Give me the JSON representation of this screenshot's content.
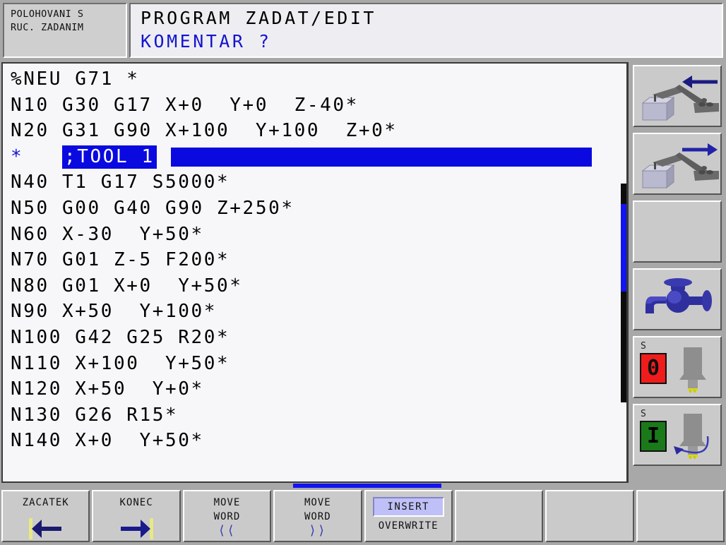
{
  "header": {
    "mode_lines": [
      "POLOHOVANI S",
      "RUC. ZADANIM"
    ],
    "title_main": "PROGRAM ZADAT/EDIT",
    "title_sub": "KOMENTAR ?"
  },
  "program": {
    "lines": [
      {
        "text": "%NEU G71 *",
        "cursor": false
      },
      {
        "text": "N10 G30 G17 X+0  Y+0  Z-40*",
        "cursor": false
      },
      {
        "text": "N20 G31 G90 X+100  Y+100  Z+0*",
        "cursor": false
      },
      {
        "text": "*",
        "highlight_word": ";TOOL 1",
        "cursor": true
      },
      {
        "text": "N40 T1 G17 S5000*",
        "cursor": false
      },
      {
        "text": "N50 G00 G40 G90 Z+250*",
        "cursor": false
      },
      {
        "text": "N60 X-30  Y+50*",
        "cursor": false
      },
      {
        "text": "N70 G01 Z-5 F200*",
        "cursor": false
      },
      {
        "text": "N80 G01 X+0  Y+50*",
        "cursor": false
      },
      {
        "text": "N90 X+50  Y+100*",
        "cursor": false
      },
      {
        "text": "N100 G42 G25 R20*",
        "cursor": false
      },
      {
        "text": "N110 X+100  Y+50*",
        "cursor": false
      },
      {
        "text": "N120 X+50  Y+0*",
        "cursor": false
      },
      {
        "text": "N130 G26 R15*",
        "cursor": false
      },
      {
        "text": "N140 X+0  Y+50*",
        "cursor": false
      }
    ],
    "scrollbar": {
      "position_pct": 27,
      "thumb_size_pct": 40
    }
  },
  "right_column": {
    "keys": [
      {
        "name": "machine-left",
        "icon": "machine-arm-arrow-left-icon",
        "label": ""
      },
      {
        "name": "machine-right",
        "icon": "machine-arm-arrow-right-icon",
        "label": ""
      },
      {
        "name": "blank-key",
        "icon": "",
        "label": ""
      },
      {
        "name": "coolant",
        "icon": "faucet-icon",
        "label": ""
      },
      {
        "name": "spindle-stop",
        "icon": "spindle-tool-icon",
        "axis_label": "S",
        "state_value": "0",
        "state_color": "#f01c1c"
      },
      {
        "name": "spindle-run",
        "icon": "spindle-tool-rotating-icon",
        "axis_label": "S",
        "state_value": "I",
        "state_color": "#1a7a1a"
      }
    ]
  },
  "softkeys": [
    {
      "lines": [
        "ZACATEK"
      ],
      "icon": "arrow-left-to-bar-icon",
      "selected": false
    },
    {
      "lines": [
        "KONEC"
      ],
      "icon": "arrow-right-to-bar-icon",
      "selected": false
    },
    {
      "lines": [
        "MOVE",
        "WORD"
      ],
      "chevron": "<<",
      "selected": false
    },
    {
      "lines": [
        "MOVE",
        "WORD"
      ],
      "chevron": ">>",
      "selected": false
    },
    {
      "lines": [],
      "toggle_on": "INSERT",
      "toggle_off": "OVERWRITE",
      "selected": true
    },
    {
      "lines": [],
      "selected": false
    },
    {
      "lines": [],
      "selected": false
    },
    {
      "lines": [],
      "selected": false
    }
  ],
  "colors": {
    "accent_blue": "#0a0ae0",
    "panel_gray": "#a8a8a8",
    "key_gray": "#cacaca",
    "text_bg": "#f7f7f9",
    "status_red": "#f01c1c",
    "status_green": "#1a7a1a",
    "highlight_lavender": "#c0c0f8"
  }
}
